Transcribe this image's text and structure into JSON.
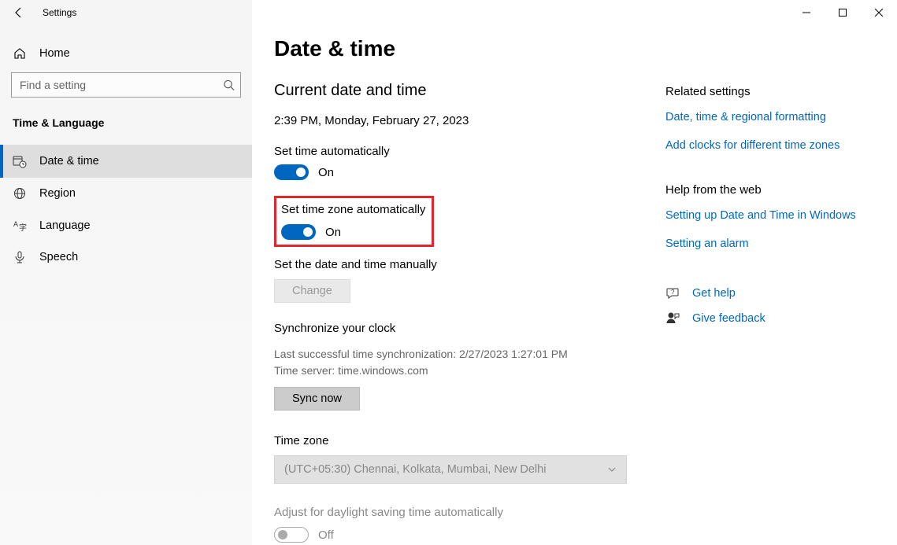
{
  "window": {
    "title": "Settings"
  },
  "sidebar": {
    "home_label": "Home",
    "search_placeholder": "Find a setting",
    "section_title": "Time & Language",
    "items": [
      {
        "label": "Date & time"
      },
      {
        "label": "Region"
      },
      {
        "label": "Language"
      },
      {
        "label": "Speech"
      }
    ]
  },
  "page": {
    "title": "Date & time",
    "current_heading": "Current date and time",
    "current_value": "2:39 PM, Monday, February 27, 2023",
    "set_time_auto_label": "Set time automatically",
    "set_time_auto_state": "On",
    "set_tz_auto_label": "Set time zone automatically",
    "set_tz_auto_state": "On",
    "set_manual_label": "Set the date and time manually",
    "change_button": "Change",
    "sync_heading": "Synchronize your clock",
    "sync_last": "Last successful time synchronization: 2/27/2023 1:27:01 PM",
    "sync_server": "Time server: time.windows.com",
    "sync_button": "Sync now",
    "tz_label": "Time zone",
    "tz_value": "(UTC+05:30) Chennai, Kolkata, Mumbai, New Delhi",
    "dst_label": "Adjust for daylight saving time automatically",
    "dst_state": "Off"
  },
  "right": {
    "related_title": "Related settings",
    "links": [
      "Date, time & regional formatting",
      "Add clocks for different time zones"
    ],
    "help_title": "Help from the web",
    "help_links": [
      "Setting up Date and Time in Windows",
      "Setting an alarm"
    ],
    "get_help": "Get help",
    "give_feedback": "Give feedback"
  }
}
